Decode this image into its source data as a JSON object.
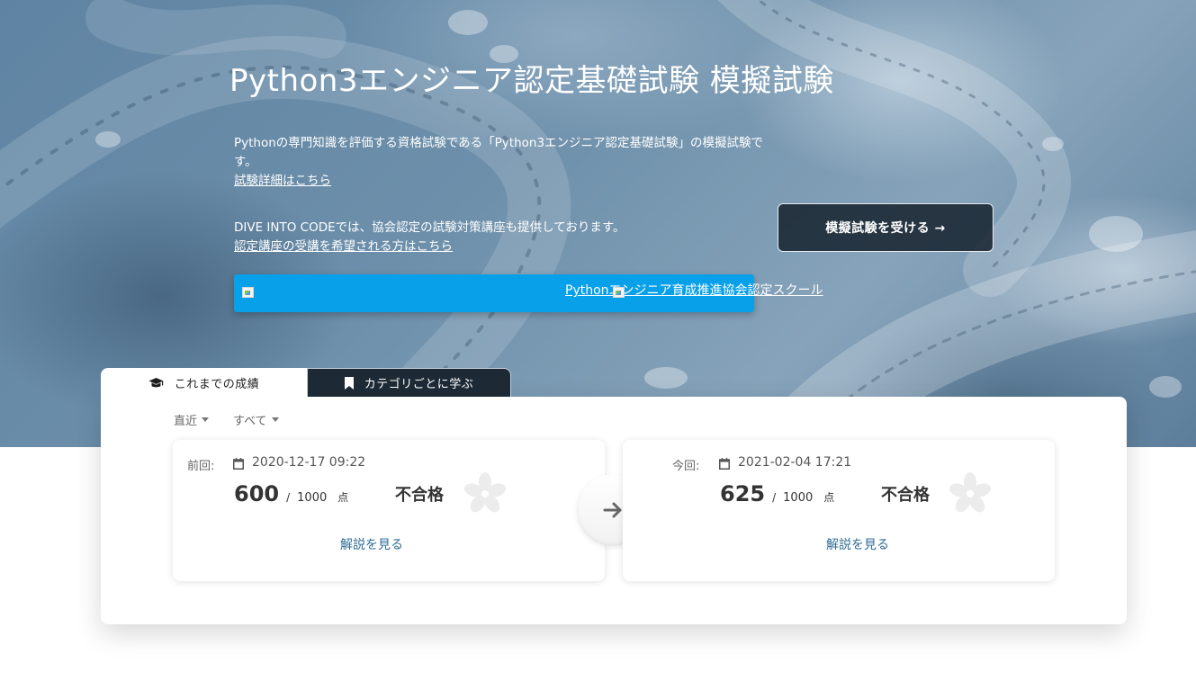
{
  "hero": {
    "title": "Python3エンジニア認定基礎試験  模擬試験",
    "description1": "Pythonの専門知識を評価する資格試験である「Python3エンジニア認定基礎試験」の模擬試験です。",
    "exam_details_link": "試験詳細はこちら",
    "description2": "DIVE INTO CODEでは、協会認定の試験対策講座も提供しております。",
    "course_link": "認定講座の受講を希望される方はこちら",
    "school_link": "Pythonエンジニア育成推進協会認定スクール",
    "cta_label": "模擬試験を受ける →"
  },
  "tabs": [
    {
      "label": "これまでの成績",
      "icon": "graduation-cap-icon",
      "active": true
    },
    {
      "label": "カテゴリごとに学ぶ",
      "icon": "bookmark-icon",
      "active": false
    }
  ],
  "filters": {
    "period": "直近",
    "category": "すべて"
  },
  "previous": {
    "label": "前回:",
    "date": "2020-12-17 09:22",
    "score": "600",
    "separator": "/",
    "max": "1000",
    "unit": "点",
    "result": "不合格",
    "explain": "解説を見る"
  },
  "current": {
    "label": "今回:",
    "date": "2021-02-04 17:21",
    "score": "625",
    "separator": "/",
    "max": "1000",
    "unit": "点",
    "result": "不合格",
    "explain": "解説を見る"
  },
  "colors": {
    "school_bar": "#08a0e8",
    "cta_bg": "#16222e",
    "link": "#2f6b96",
    "tab_dark": "#1d2a36"
  }
}
